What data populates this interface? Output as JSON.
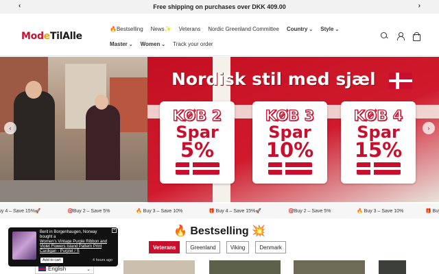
{
  "announcement": {
    "text": "Free shipping on purchases over DKK 409.00",
    "prev": "‹",
    "next": "›"
  },
  "logo": {
    "part1": "Mod",
    "part2": "e",
    "part3": "TilAlle"
  },
  "nav": {
    "row1": [
      "🔥Bestselling",
      "News✨",
      "Veterans",
      "Nordic Greenland Committee",
      "Country",
      "Style"
    ],
    "row2": [
      "Master",
      "Women",
      "Track your order"
    ]
  },
  "hero": {
    "headline": "Nordisk stil med sjæl",
    "offers": [
      {
        "buy": "KØB 2",
        "save": "Spar",
        "pct": "5%"
      },
      {
        "buy": "KØB 3",
        "save": "Spar",
        "pct": "10%"
      },
      {
        "buy": "KØB 4",
        "save": "Spar",
        "pct": "15%"
      }
    ],
    "prev": "‹",
    "next": "›"
  },
  "marquee": [
    "uy 4 – Save 15%🚀",
    "🎯Buy 2 – Save 5%",
    "🔥 Buy 3 – Save 10%",
    "🎁 Buy 4 – Save 15%🚀",
    "🎯Buy 2 – Save 5%",
    "🔥 Buy 3 – Save 10%",
    "🎁 Buy 4 – S"
  ],
  "section": {
    "title": "🔥 Bestselling 💥"
  },
  "tabs": [
    "Veterans",
    "Greenland",
    "Viking",
    "Denmark"
  ],
  "popup": {
    "line1": "Berit in Borgenhaugen, Norway",
    "line2": "bought a",
    "product": "Women's Vintage Purple Ribbon and Violet Flowers Island Pattern Print Cardigan - Purplet / S",
    "cta": "Add to cart",
    "ago": "4 hours ago",
    "close": "×"
  },
  "language": {
    "label": "English",
    "chevron": "⌄"
  },
  "colors": {
    "accent": "#c8102e",
    "dark": "#111111"
  }
}
